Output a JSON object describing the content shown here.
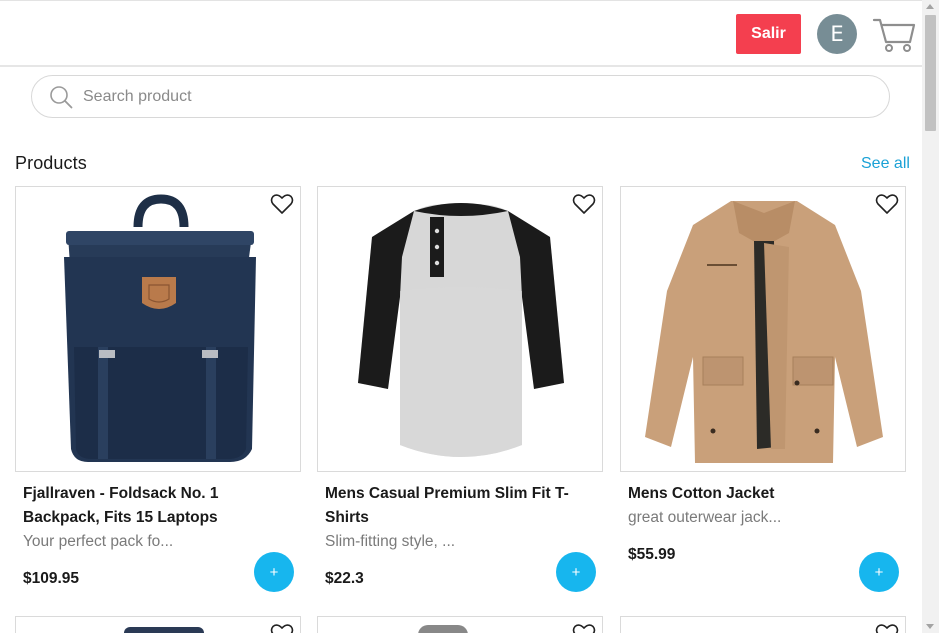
{
  "header": {
    "logout_label": "Salir",
    "avatar_initial": "E",
    "cart_icon": "cart-icon"
  },
  "search": {
    "placeholder": "Search product",
    "icon": "search-icon"
  },
  "section": {
    "title": "Products",
    "see_all_label": "See all"
  },
  "products": [
    {
      "name": "Fjallraven - Foldsack No. 1 Backpack, Fits 15 Laptops",
      "description": "Your perfect pack fo...",
      "price": "$109.95",
      "add_label": "+",
      "image": "backpack-image"
    },
    {
      "name": "Mens Casual Premium Slim Fit T-Shirts",
      "description": "Slim-fitting style, ...",
      "price": "$22.3",
      "add_label": "+",
      "image": "tshirt-image"
    },
    {
      "name": "Mens Cotton Jacket",
      "description": "great outerwear jack...",
      "price": "$55.99",
      "add_label": "+",
      "image": "jacket-image"
    }
  ],
  "colors": {
    "logout_bg": "#f43f4f",
    "accent": "#17b6ee",
    "link": "#1aa1d6",
    "avatar_bg": "#778d95"
  }
}
